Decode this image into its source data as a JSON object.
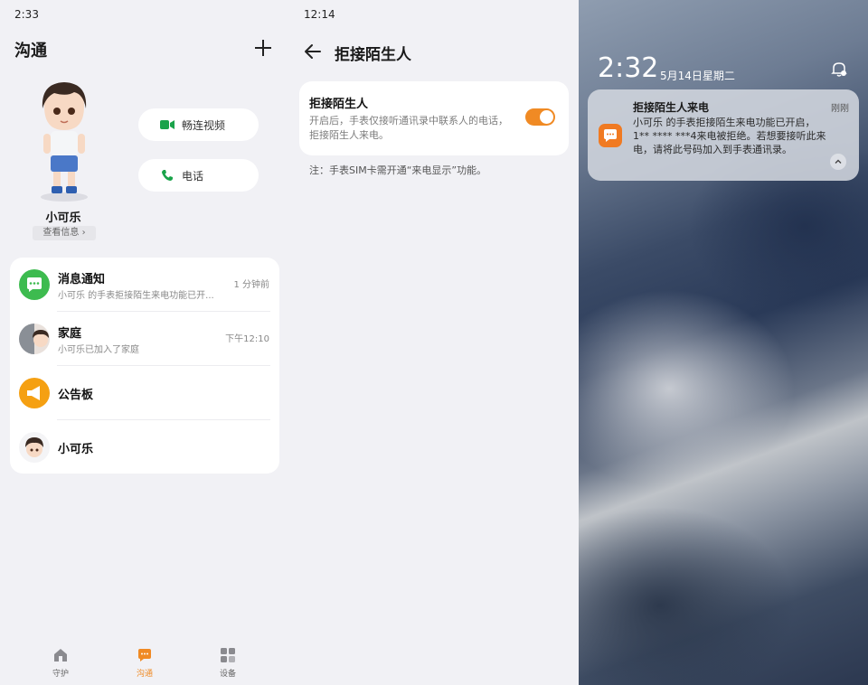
{
  "panel1": {
    "status_time": "2:33",
    "title": "沟通",
    "contact_name": "小可乐",
    "view_info": "查看信息",
    "actions": {
      "video": "畅连视频",
      "call": "电话"
    },
    "list": [
      {
        "title": "消息通知",
        "subtitle": "小可乐 的手表拒接陌生来电功能已开...",
        "time": "1 分钟前"
      },
      {
        "title": "家庭",
        "subtitle": "小可乐已加入了家庭",
        "time": "下午12:10"
      },
      {
        "title": "公告板",
        "subtitle": "",
        "time": ""
      },
      {
        "title": "小可乐",
        "subtitle": "",
        "time": ""
      }
    ],
    "tabs": [
      {
        "label": "守护",
        "icon": "home-icon"
      },
      {
        "label": "沟通",
        "icon": "chat-icon",
        "active": true
      },
      {
        "label": "设备",
        "icon": "grid-icon"
      }
    ],
    "accent": "#f08a24"
  },
  "panel2": {
    "status_time": "12:14",
    "title": "拒接陌生人",
    "setting_title": "拒接陌生人",
    "setting_desc": "开启后，手表仅接听通讯录中联系人的电话，拒接陌生人来电。",
    "toggle_on": true,
    "note": "注：手表SIM卡需开通“来电显示”功能。"
  },
  "panel3": {
    "lock_time": "2:32",
    "lock_date": "5月14日星期二",
    "notification": {
      "title": "拒接陌生人来电",
      "time": "刚刚",
      "body": "小可乐 的手表拒接陌生来电功能已开启，1** **** ***4来电被拒绝。若想要接听此来电，请将此号码加入到手表通讯录。"
    }
  }
}
